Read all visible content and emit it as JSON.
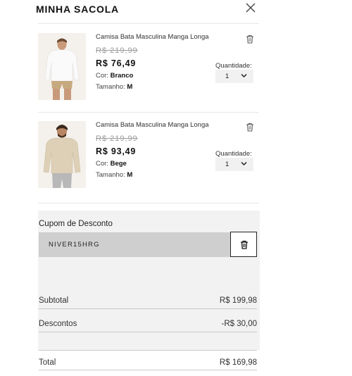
{
  "header": {
    "title": "MINHA SACOLA",
    "close_icon": "close-icon"
  },
  "items": [
    {
      "name": "Camisa Bata Masculina Manga Longa",
      "old_price": "R$ 219,99",
      "price": "R$ 76,49",
      "color_label": "Cor:",
      "color_value": "Branco",
      "size_label": "Tamanho:",
      "size_value": "M",
      "quantity_label": "Quantidade:",
      "quantity_value": "1"
    },
    {
      "name": "Camisa Bata Masculina Manga Longa",
      "old_price": "R$ 219,99",
      "price": "R$ 93,49",
      "color_label": "Cor:",
      "color_value": "Bege",
      "size_label": "Tamanho:",
      "size_value": "M",
      "quantity_label": "Quantidade:",
      "quantity_value": "1"
    }
  ],
  "coupon": {
    "title": "Cupom de Desconto",
    "code": "NIVER15HRG"
  },
  "summary": {
    "subtotal_label": "Subtotal",
    "subtotal_value": "R$ 199,98",
    "discount_label": "Descontos",
    "discount_value": "-R$ 30,00",
    "total_label": "Total",
    "total_value": "R$ 169,98"
  }
}
